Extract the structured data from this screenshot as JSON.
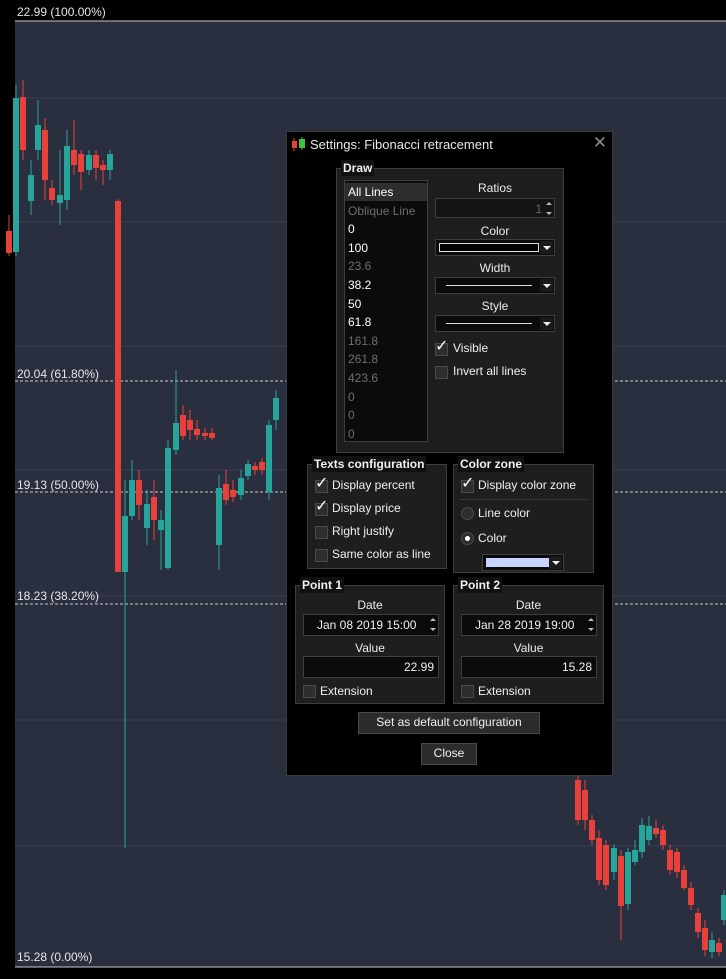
{
  "chart": {
    "axis_labels": {
      "top": "22.99 (100.00%)",
      "l61": "20.04 (61.80%)",
      "l50": "19.13 (50.00%)",
      "l38": "18.23 (38.20%)",
      "bottom": "15.28 (0.00%)"
    },
    "colors": {
      "background": "#2a2f3f",
      "up": "#27a59a",
      "down": "#e8403a",
      "fib_line": "#c8c8c8"
    }
  },
  "dialog": {
    "title": "Settings: Fibonacci retracement",
    "close_glyph": "✕",
    "draw": {
      "title": "Draw",
      "lines": [
        {
          "label": "All Lines",
          "enabled": true,
          "selected": true
        },
        {
          "label": "Oblique Line",
          "enabled": false
        },
        {
          "label": "0",
          "enabled": true
        },
        {
          "label": "100",
          "enabled": true
        },
        {
          "label": "23.6",
          "enabled": false
        },
        {
          "label": "38.2",
          "enabled": true
        },
        {
          "label": "50",
          "enabled": true
        },
        {
          "label": "61.8",
          "enabled": true
        },
        {
          "label": "161.8",
          "enabled": false
        },
        {
          "label": "261.8",
          "enabled": false
        },
        {
          "label": "423.6",
          "enabled": false
        },
        {
          "label": "0",
          "enabled": false
        },
        {
          "label": "0",
          "enabled": false
        },
        {
          "label": "0",
          "enabled": false
        }
      ],
      "ratios_label": "Ratios",
      "ratios_value": "1",
      "color_label": "Color",
      "color_value": "#000000",
      "width_label": "Width",
      "style_label": "Style",
      "visible_label": "Visible",
      "visible_checked": true,
      "invert_label": "Invert all lines",
      "invert_checked": false
    },
    "texts": {
      "title": "Texts configuration",
      "display_percent": "Display percent",
      "display_price": "Display price",
      "right_justify": "Right justify",
      "same_color": "Same color as line"
    },
    "color_zone": {
      "title": "Color zone",
      "display_color_zone": "Display color zone",
      "line_color": "Line color",
      "color": "Color",
      "swatch": "#c6d4ff"
    },
    "point1": {
      "title": "Point 1",
      "date_label": "Date",
      "date": "Jan 08 2019 15:00",
      "value_label": "Value",
      "value": "22.99",
      "extension": "Extension"
    },
    "point2": {
      "title": "Point 2",
      "date_label": "Date",
      "date": "Jan 28 2019 19:00",
      "value_label": "Value",
      "value": "15.28",
      "extension": "Extension"
    },
    "default_button": "Set as default configuration",
    "close_button": "Close"
  }
}
